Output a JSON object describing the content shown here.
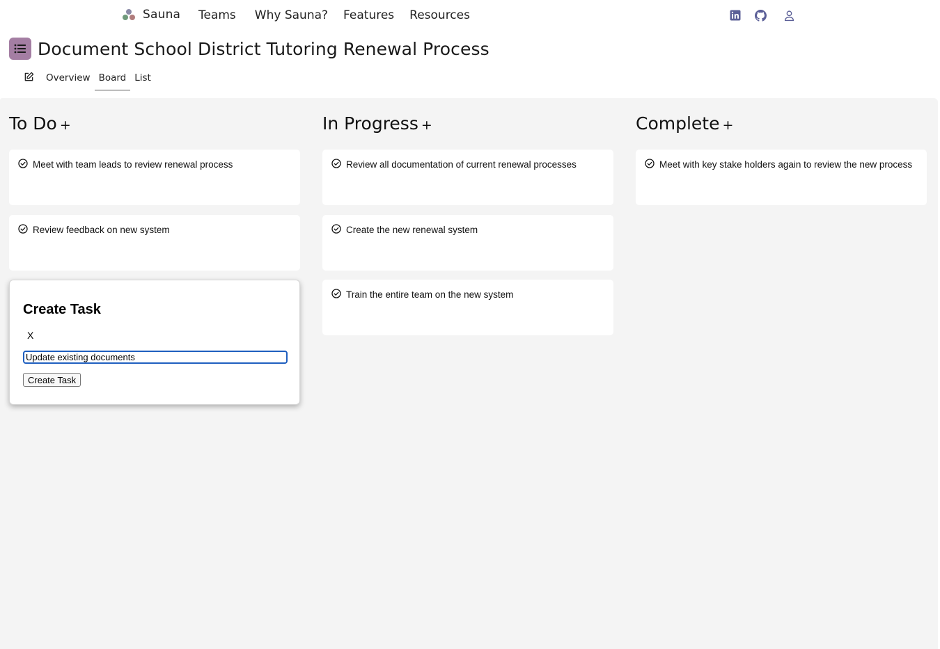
{
  "nav": {
    "brand": "Sauna",
    "links": [
      "Teams",
      "Why Sauna?",
      "Features",
      "Resources"
    ],
    "icons": [
      "linkedin-icon",
      "github-icon",
      "user-icon"
    ]
  },
  "project": {
    "title": "Document School District Tutoring Renewal Process",
    "icon": "list-icon",
    "icon_color": "#a47ea3"
  },
  "tabs": [
    "Overview",
    "Board",
    "List"
  ],
  "active_tab": "Board",
  "board": {
    "columns": [
      {
        "title": "To Do",
        "add": "+",
        "cards": [
          "Meet with team leads to review renewal process",
          "Review feedback on new system"
        ]
      },
      {
        "title": "In Progress",
        "add": "+",
        "cards": [
          "Review all documentation of current renewal processes",
          "Create the new renewal system",
          "Train the entire team on the new system"
        ]
      },
      {
        "title": "Complete",
        "add": "+",
        "cards": [
          "Meet with key stake holders again to review the new process"
        ]
      }
    ]
  },
  "modal": {
    "title": "Create Task",
    "close": "X",
    "input_value": "Update existing documents",
    "button": "Create Task"
  },
  "colors": {
    "board_bg": "#f4f4f4",
    "accent": "#a47ea3",
    "icon_color": "#5b5f97",
    "input_focus": "#1f5fbf"
  }
}
